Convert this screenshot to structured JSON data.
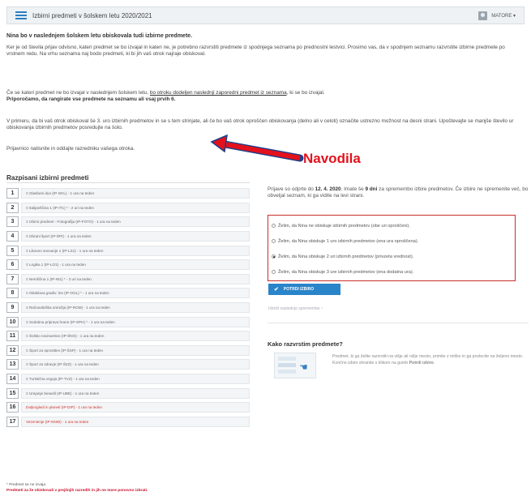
{
  "header": {
    "title": "Izbirni predmeti v šolskem letu 2020/2021",
    "user_label": "MATORE ▾"
  },
  "intro": {
    "heading": "Nina bo v naslednjem šolskem letu obiskovala tudi izbirne predmete.",
    "p1": "Ker je od števila prijav odvisno, kateri predmet se bo izvajal in kateri ne, je potrebno razvrstiti predmete iz spodnjega seznama po prednostni lestvici. Prosimo vas, da v spodnjem seznamu razvrstite izbirne predmete po vrstnem redu. Na vrhu seznama naj bodo predmeti, ki bi jih vaš otrok najraje obiskoval.",
    "p2_a": "Če se kateri predmet ne bo izvajal v naslednjem šolskem letu, ",
    "p2_link": "bo otroku dodeljen naslednji zaporedni predmet iz seznama",
    "p2_b": ", ki se bo izvajal.",
    "p2_bold": "Priporočamo, da rangirate vse predmete na seznamu ali vsaj prvih 6.",
    "p3": "V primeru, da bi vaš otrok obiskoval še 3. uro izbirnih predmetov in se s tem strinjate, ali če bo vaš otrok oproščen obiskovanja (delno ali v celoti) označite ustrezno možnost na desni strani. Upoštevajte se manjše število ur obiskovanja izbirnih predmetov posredujte na šolo.",
    "p4": "Prijavnico natisnite in oddajte razredniku vašega otroka."
  },
  "annotation": {
    "label": "Navodila",
    "color": "#e3111c"
  },
  "subjects": {
    "title": "Razpisani izbirni predmeti",
    "items": [
      {
        "n": "1",
        "text": "≡  Glasbeni duo (IP-GKL) - 1 ura na teden",
        "red": false
      },
      {
        "n": "2",
        "text": "≡  Italijanščina 1 (IP-IT1) * - 2 uri na teden",
        "red": false
      },
      {
        "n": "3",
        "text": "≡  Izbirni predmet - Fotografija (IP-FOTO) - 1 ura na teden",
        "red": false
      },
      {
        "n": "4",
        "text": "≡  Izbrani šport (IP-ŠPI) - 1 ura na teden",
        "red": false
      },
      {
        "n": "5",
        "text": "≡  Likovno snovanje 1 (IP-LS1) - 1 ura na teden",
        "red": false
      },
      {
        "n": "6",
        "text": "≡  Logika 1 (IP-LO1) - 1 ura na teden",
        "red": false
      },
      {
        "n": "7",
        "text": "≡  Nemščina 1 (IP-NI1) * - 2 uri na teden",
        "red": false
      },
      {
        "n": "8",
        "text": "≡  Obdelava gradiv: les (IP-OGL) * - 1 ura na teden",
        "red": false
      },
      {
        "n": "9",
        "text": "≡  Računalniška omrežja (IP-ROM) - 1 ura na teden",
        "red": false
      },
      {
        "n": "10",
        "text": "≡  Sodobna priprava hrane (IP-SPH) * - 1 ura na teden",
        "red": false
      },
      {
        "n": "11",
        "text": "≡  Šolsko novinarstvo (IP-ŠNO) - 1 ura na teden",
        "red": false
      },
      {
        "n": "12",
        "text": "≡  Šport za sprostitev (IP-ŠSP) - 1 ura na teden",
        "red": false
      },
      {
        "n": "13",
        "text": "≡  Šport za zdravje (IP-ŠZZ) - 1 ura na teden",
        "red": false
      },
      {
        "n": "14",
        "text": "≡  Turistična vzgoja (IP-TVZ) - 1 ura na teden",
        "red": false
      },
      {
        "n": "15",
        "text": "≡  Urejanje besedil (IP-UBE) - 1 ura na teden",
        "red": false
      },
      {
        "n": "16",
        "text": "Daljnogledi in planeti (IP-DIP) - 1 ura na teden",
        "red": true
      },
      {
        "n": "17",
        "text": "Vezenienje (IP-NNW) - 1 ura na teden",
        "red": true
      }
    ],
    "foot_note": "* Predmet se ne izvaja",
    "foot_red": "Predmeti za že obiskovali v prejšnjih razredih in jih ne more ponovno izbrati."
  },
  "right": {
    "info_a": "Prijave so odprte do ",
    "info_date": "12. 4. 2020",
    "info_b": ". Imate še ",
    "info_days": "9 dni",
    "info_c": " za spremembo izbire predmetov. Če izbire ne spremenite več, bo obveljal seznam, ki ga vidite na levi strani.",
    "options": [
      {
        "label": "Želim, da Nina ne obiskuje izbirnih predmetov (obe uri oproščeni).",
        "selected": false
      },
      {
        "label": "Želim, da Nina obiskuje 1 uro izbirnih predmetov (ena ura oproščena).",
        "selected": false
      },
      {
        "label": "Želim, da Nina obiskuje 2 uri izbirnih predmetov (privzeta vrednost).",
        "selected": true
      },
      {
        "label": "Želim, da Nina obiskuje 3 ure izbirnih predmetov (ena dodatna ura).",
        "selected": false
      }
    ],
    "confirm_label": "POTRDI IZBIRO",
    "history_link": "Izbriši naslednje spremembe ↑",
    "howto_title": "Kako razvrstim predmete?",
    "howto_text_a": "Predmet, ki ga želite razvrstiti na višje ali nižje mesto, primite z miško in ga povlecite na željeno mesto. Končno izbiro shranite s klikom na gumb ",
    "howto_text_b": "Potrdi izbiro",
    "howto_text_c": "."
  }
}
